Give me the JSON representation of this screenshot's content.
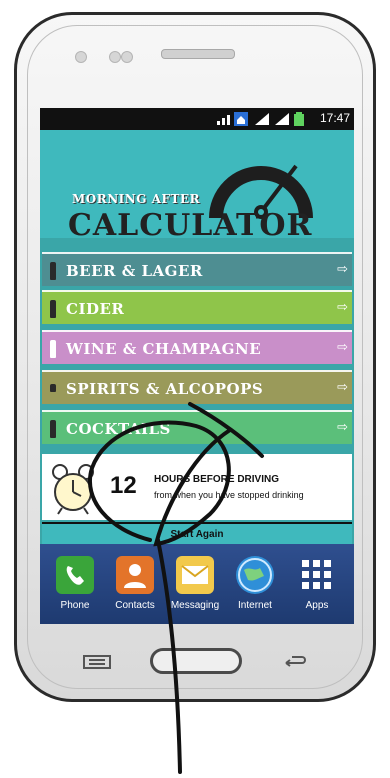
{
  "status_bar": {
    "time": "17:47"
  },
  "banner": {
    "title_small": "MORNING AFTER",
    "title_big": "CALCULATOR"
  },
  "menu": {
    "items": [
      {
        "label": "BEER & LAGER",
        "color": "#4e8e92"
      },
      {
        "label": "CIDER",
        "color": "#8fc54a"
      },
      {
        "label": "WINE & CHAMPAGNE",
        "color": "#c98fc9"
      },
      {
        "label": "SPIRITS & ALCOPOPS",
        "color": "#9a9a5a"
      },
      {
        "label": "COCKTAILS",
        "color": "#5bbf7a"
      }
    ],
    "arrow_icon": "arrow-right-icon"
  },
  "result": {
    "hours": "12",
    "line1": "HOURS BEFORE DRIVING",
    "line2": "from when you have stopped drinking"
  },
  "start_again": "Start Again",
  "dock": {
    "items": [
      {
        "label": "Phone",
        "icon": "phone-icon",
        "color": "#3aa53a"
      },
      {
        "label": "Contacts",
        "icon": "contacts-icon",
        "color": "#e3742a"
      },
      {
        "label": "Messaging",
        "icon": "messaging-icon",
        "color": "#f2c94c"
      },
      {
        "label": "Internet",
        "icon": "globe-icon",
        "color": "#2f8fd8"
      },
      {
        "label": "Apps",
        "icon": "apps-grid-icon",
        "color": "#ffffff"
      }
    ]
  }
}
